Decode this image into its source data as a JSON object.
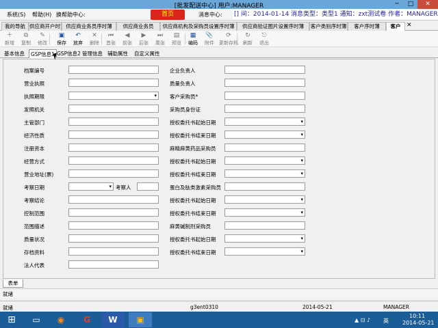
{
  "window": {
    "title": "[批发配送中心] 用户:MANAGER",
    "min": "─",
    "max": "□",
    "close": "✕"
  },
  "menu": {
    "items": [
      "系统(S)",
      "帮助(H)",
      "换帮助中心:"
    ],
    "msg_button": "首页",
    "msg_label": "消息中心:",
    "notice": "[] 间：2014-01-14 消息类型：类型1 通知：zxt测试卷 作者：MANAGER 发布"
  },
  "tabs": [
    "我的导航",
    "供应商开户时薄",
    "供应商业务员序时薄",
    "供应商业务员",
    "供应商机构及采购员设置序时薄",
    "供应商验证图片设置序时薄",
    "客户类别序时薄",
    "客户序时薄",
    "客户"
  ],
  "tab_close": "✕",
  "toolbar": [
    {
      "label": "新增",
      "icon": "＋",
      "enabled": false
    },
    {
      "label": "复制",
      "icon": "⧉",
      "enabled": false
    },
    {
      "label": "修改",
      "icon": "✎",
      "enabled": false
    },
    {
      "label": "保存",
      "icon": "▣",
      "enabled": true
    },
    {
      "label": "放弃",
      "icon": "↶",
      "enabled": true
    },
    {
      "label": "删除",
      "icon": "✕",
      "enabled": false
    },
    {
      "label": "首张",
      "icon": "⏮",
      "enabled": false
    },
    {
      "label": "前张",
      "icon": "◀",
      "enabled": false
    },
    {
      "label": "后张",
      "icon": "▶",
      "enabled": false
    },
    {
      "label": "尾张",
      "icon": "⏭",
      "enabled": false
    },
    {
      "label": "预览",
      "icon": "▤",
      "enabled": false
    },
    {
      "label": "编码",
      "icon": "▦",
      "enabled": true
    },
    {
      "label": "附件",
      "icon": "📎",
      "enabled": false
    },
    {
      "label": "更新存档",
      "icon": "⟳",
      "enabled": false
    },
    {
      "label": "刷新",
      "icon": "↻",
      "enabled": false
    },
    {
      "label": "退出",
      "icon": "⎋",
      "enabled": false
    }
  ],
  "subtabs": [
    "基本信息",
    "GSP信息1",
    "GSP信息2",
    "管理信息",
    "辅助属性",
    "自定义属性"
  ],
  "form_left": [
    {
      "label": "档案编号",
      "type": "text",
      "value": ""
    },
    {
      "label": "营业执照",
      "type": "text",
      "value": ""
    },
    {
      "label": "执照期限",
      "type": "select",
      "value": ""
    },
    {
      "label": "发照机关",
      "type": "text",
      "value": ""
    },
    {
      "label": "主管部门",
      "type": "text",
      "value": ""
    },
    {
      "label": "经济性质",
      "type": "text",
      "value": ""
    },
    {
      "label": "注册资本",
      "type": "text",
      "value": ""
    },
    {
      "label": "经营方式",
      "type": "text",
      "value": ""
    },
    {
      "label": "营业地址(票)",
      "type": "text",
      "value": ""
    },
    {
      "label": "考察日期",
      "type": "select",
      "value": ""
    },
    {
      "label": "考察结论",
      "type": "text",
      "value": ""
    },
    {
      "label": "控制范围",
      "type": "text",
      "value": ""
    },
    {
      "label": "范围描述",
      "type": "text",
      "value": ""
    },
    {
      "label": "质量状况",
      "type": "text",
      "value": ""
    },
    {
      "label": "存档资料",
      "type": "text",
      "value": ""
    },
    {
      "label": "法人代表",
      "type": "text",
      "value": ""
    }
  ],
  "inspector_label": "考察人",
  "form_right": [
    {
      "label": "企业负责人",
      "type": "text",
      "value": ""
    },
    {
      "label": "质量负责人",
      "type": "text",
      "value": ""
    },
    {
      "label": "客户采购员*",
      "type": "text",
      "value": ""
    },
    {
      "label": "采购员身份证",
      "type": "text",
      "value": ""
    },
    {
      "label": "授权委托书起始日期",
      "type": "select",
      "value": ""
    },
    {
      "label": "授权委托书结束日期",
      "type": "select",
      "value": ""
    },
    {
      "label": "麻精麻黄药品采购员",
      "type": "text",
      "value": ""
    },
    {
      "label": "授权委托书起始日期",
      "type": "select",
      "value": ""
    },
    {
      "label": "授权委托书结束日期",
      "type": "select",
      "value": ""
    },
    {
      "label": "蛋白及肽类激素采购员",
      "type": "text",
      "value": ""
    },
    {
      "label": "授权委托书起始日期",
      "type": "select",
      "value": ""
    },
    {
      "label": "授权委托书结束日期",
      "type": "select",
      "value": ""
    },
    {
      "label": "麻黄碱制剂采购员",
      "type": "text",
      "value": ""
    },
    {
      "label": "授权委托书起始日期",
      "type": "select",
      "value": ""
    },
    {
      "label": "授权委托书结束日期",
      "type": "select",
      "value": ""
    }
  ],
  "bottom_tab": "表单",
  "ready_text": "就绪",
  "status": {
    "ready": "就绪",
    "machine": "g3ent0310",
    "date": "2014-05-21",
    "user": "MANAGER"
  },
  "taskbar": {
    "time": "10:11",
    "date": "2014-05-21",
    "lang": "英"
  }
}
